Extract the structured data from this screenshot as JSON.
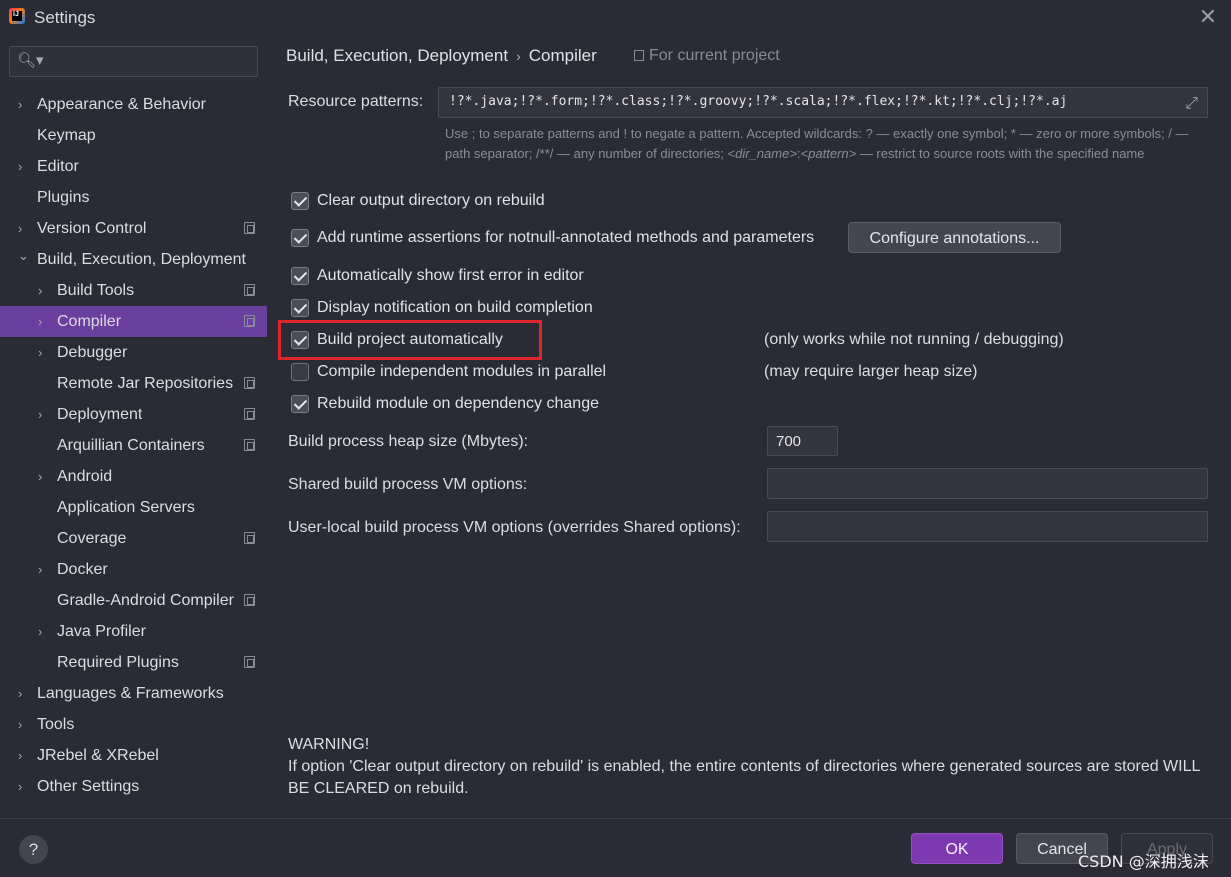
{
  "window": {
    "title": "Settings",
    "close_glyph": "✕",
    "app_icon": "intellij-idea-icon"
  },
  "search": {
    "placeholder": "",
    "value": "",
    "icon_glyph": "🔍︎▾"
  },
  "sidebar": {
    "items": [
      {
        "label": "Appearance & Behavior",
        "arrow": "›",
        "project": false
      },
      {
        "label": "Keymap",
        "arrow": "",
        "project": false
      },
      {
        "label": "Editor",
        "arrow": "›",
        "project": false
      },
      {
        "label": "Plugins",
        "arrow": "",
        "project": false
      },
      {
        "label": "Version Control",
        "arrow": "›",
        "project": true
      },
      {
        "label": "Build, Execution, Deployment",
        "arrow": "⌄",
        "project": false
      },
      {
        "label": "Build Tools",
        "arrow": "›",
        "project": true
      },
      {
        "label": "Compiler",
        "arrow": "›",
        "project": true,
        "selected": true
      },
      {
        "label": "Debugger",
        "arrow": "›",
        "project": false
      },
      {
        "label": "Remote Jar Repositories",
        "arrow": "",
        "project": true
      },
      {
        "label": "Deployment",
        "arrow": "›",
        "project": true
      },
      {
        "label": "Arquillian Containers",
        "arrow": "",
        "project": true
      },
      {
        "label": "Android",
        "arrow": "›",
        "project": false
      },
      {
        "label": "Application Servers",
        "arrow": "",
        "project": false
      },
      {
        "label": "Coverage",
        "arrow": "",
        "project": true
      },
      {
        "label": "Docker",
        "arrow": "›",
        "project": false
      },
      {
        "label": "Gradle-Android Compiler",
        "arrow": "",
        "project": true
      },
      {
        "label": "Java Profiler",
        "arrow": "›",
        "project": false
      },
      {
        "label": "Required Plugins",
        "arrow": "",
        "project": true
      },
      {
        "label": "Languages & Frameworks",
        "arrow": "›",
        "project": false
      },
      {
        "label": "Tools",
        "arrow": "›",
        "project": false
      },
      {
        "label": "JRebel & XRebel",
        "arrow": "›",
        "project": false
      },
      {
        "label": "Other Settings",
        "arrow": "›",
        "project": false
      }
    ]
  },
  "breadcrumb": {
    "parent": "Build, Execution, Deployment",
    "separator": "›",
    "current": "Compiler",
    "scope": "For current project"
  },
  "resource_patterns": {
    "label": "Resource patterns:",
    "value": "!?*.java;!?*.form;!?*.class;!?*.groovy;!?*.scala;!?*.flex;!?*.kt;!?*.clj;!?*.aj",
    "expand_glyph": "⤢",
    "hint_part1": "Use ; to separate patterns and ! to negate a pattern. Accepted wildcards: ? — exactly one symbol; * — zero or more symbols; / — path separator; /**/ — any number of directories; ",
    "hint_dir": "<dir_name>",
    "hint_colon": ":",
    "hint_pattern": "<pattern>",
    "hint_part2": " — restrict to source roots with the specified name"
  },
  "options": {
    "clear_output": {
      "label": "Clear output directory on rebuild",
      "checked": true
    },
    "runtime_assertions": {
      "label": "Add runtime assertions for notnull-annotated methods and parameters",
      "checked": true
    },
    "configure_annotations": "Configure annotations...",
    "show_first_error": {
      "label": "Automatically show first error in editor",
      "checked": true
    },
    "notify_completion": {
      "label": "Display notification on build completion",
      "checked": true
    },
    "build_automatically": {
      "label": "Build project automatically",
      "checked": true,
      "note": "(only works while not running / debugging)"
    },
    "compile_parallel": {
      "label": "Compile independent modules in parallel",
      "checked": false,
      "note": "(may require larger heap size)"
    },
    "rebuild_on_dependency": {
      "label": "Rebuild module on dependency change",
      "checked": true
    }
  },
  "heap": {
    "label": "Build process heap size (Mbytes):",
    "value": "700"
  },
  "shared_vm": {
    "label": "Shared build process VM options:",
    "value": ""
  },
  "user_vm": {
    "label": "User-local build process VM options (overrides Shared options):",
    "value": ""
  },
  "warning": {
    "title": "WARNING!",
    "body": "If option 'Clear output directory on rebuild' is enabled, the entire contents of directories where generated sources are stored WILL BE CLEARED on rebuild."
  },
  "footer": {
    "help": "?",
    "ok": "OK",
    "cancel": "Cancel",
    "apply": "Apply",
    "watermark": "CSDN @深拥浅沫"
  },
  "colors": {
    "selection": "#6b3fa0",
    "ok_button": "#7d3ab0",
    "highlight": "#e0262b",
    "background": "#2b2b35"
  }
}
